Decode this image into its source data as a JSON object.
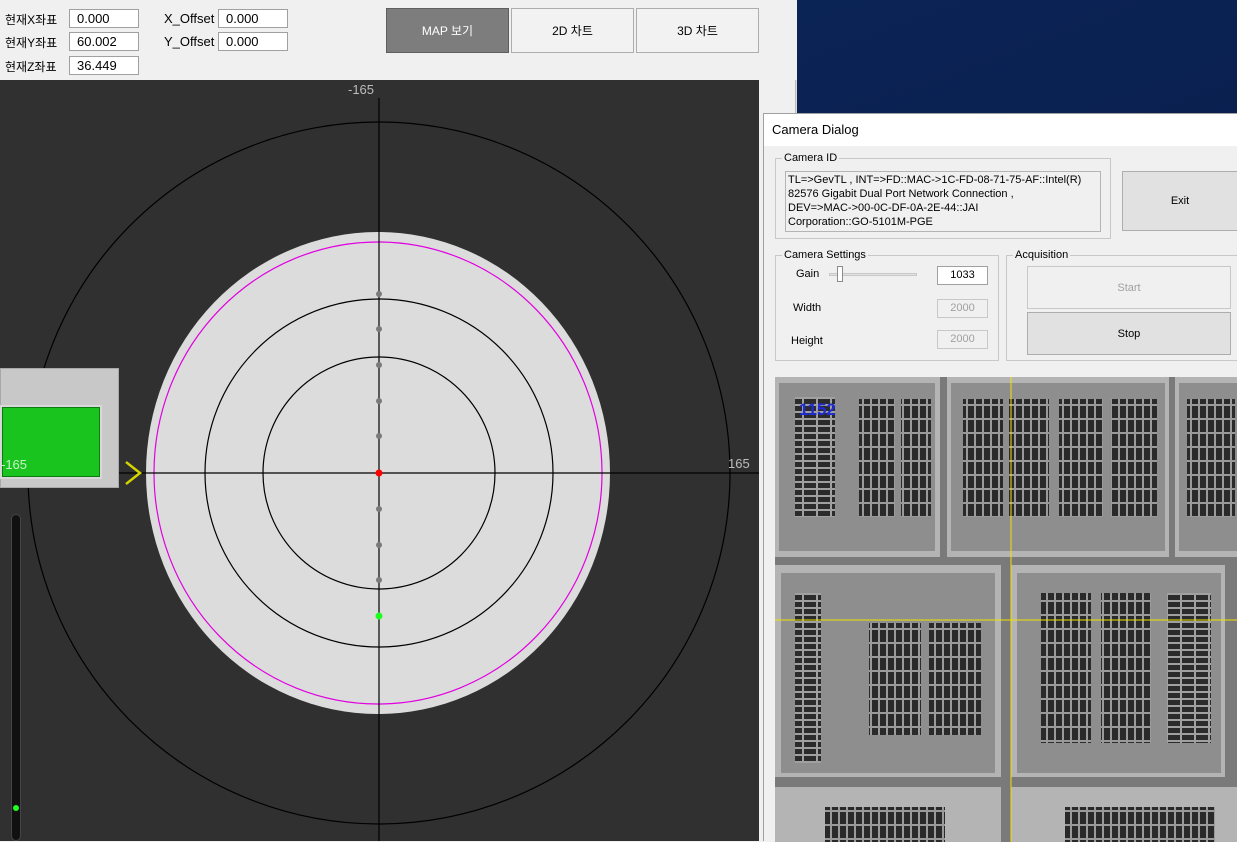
{
  "top": {
    "x_label": "현재X좌표",
    "x_value": "0.000",
    "y_label": "현재Y좌표",
    "y_value": "60.002",
    "z_label": "현재Z좌표",
    "z_value": "36.449",
    "xoff_label": "X_Offset",
    "xoff_value": "0.000",
    "yoff_label": "Y_Offset",
    "yoff_value": "0.000",
    "buttons": {
      "map": "MAP 보기",
      "chart2d": "2D 차트",
      "chart3d": "3D 차트"
    }
  },
  "map": {
    "label_top": "-165",
    "label_left": "-165",
    "label_right": "165",
    "indicator_arrow": ">",
    "colors": {
      "background": "#303030",
      "wafer": "#dcdcdc",
      "edge_ring": "#e000e0",
      "center_point": "#ff0000",
      "current_point": "#20ff20",
      "arrow": "#d4d400"
    }
  },
  "camera_dialog": {
    "title": "Camera Dialog",
    "camera_id_group": "Camera ID",
    "camera_id_text": "TL=>GevTL , INT=>FD::MAC->1C-FD-08-71-75-AF::Intel(R)\n82576 Gigabit Dual Port Network Connection ,\nDEV=>MAC->00-0C-DF-0A-2E-44::JAI\nCorporation::GO-5101M-PGE",
    "exit_label": "Exit",
    "settings_group": "Camera Settings",
    "gain_label": "Gain",
    "gain_value": "1033",
    "width_label": "Width",
    "width_value": "2000",
    "height_label": "Height",
    "height_value": "2000",
    "acquisition_group": "Acquisition",
    "start_label": "Start",
    "stop_label": "Stop",
    "frame_counter": "1152",
    "crosshair_color": "#f0e000"
  }
}
